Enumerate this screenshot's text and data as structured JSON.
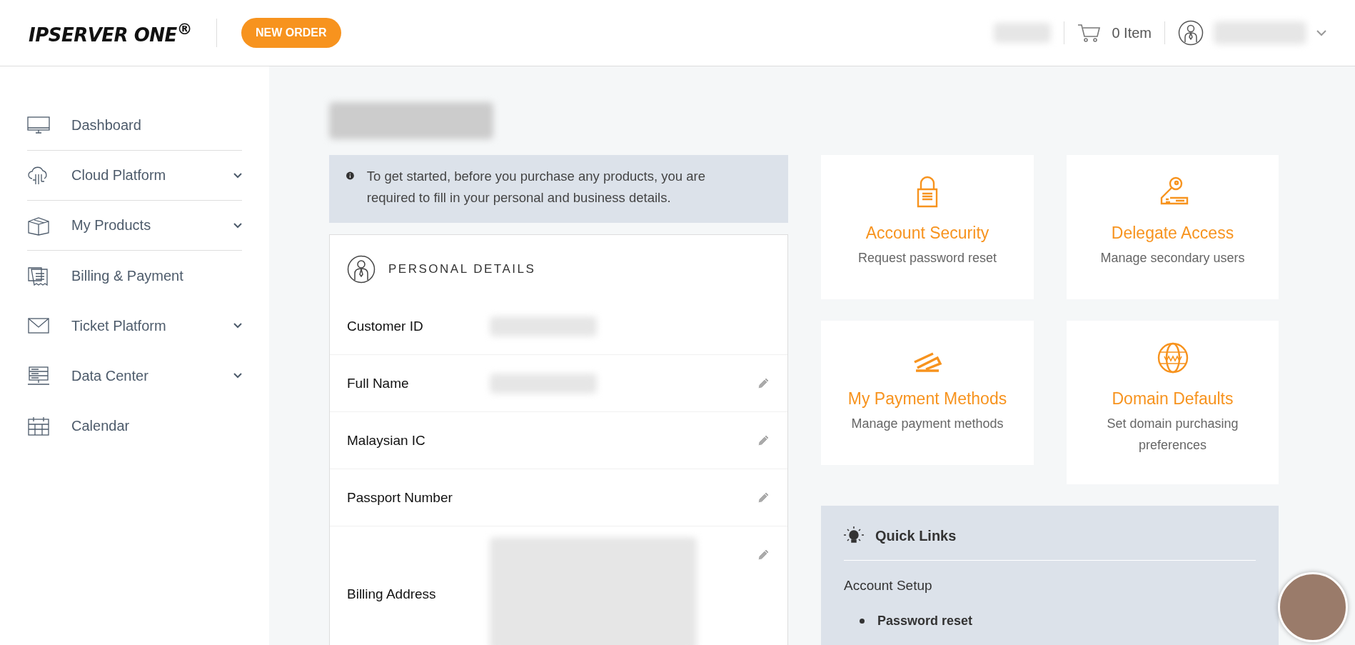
{
  "header": {
    "logo": "IPSERVER ONE$^{®}$",
    "new_order": "NEW ORDER",
    "cart": "0 Item"
  },
  "sidebar": {
    "items": [
      {
        "label": "Dashboard",
        "kind": "monitor",
        "expandable": false,
        "divider": true
      },
      {
        "label": "Cloud Platform",
        "kind": "cloud",
        "expandable": true,
        "divider": true
      },
      {
        "label": "My Products",
        "kind": "box",
        "expandable": true,
        "divider": true
      },
      {
        "label": "Billing & Payment",
        "kind": "receipt",
        "expandable": false,
        "divider": false
      },
      {
        "label": "Ticket Platform",
        "kind": "mail",
        "expandable": true,
        "divider": false
      },
      {
        "label": "Data Center",
        "kind": "server",
        "expandable": true,
        "divider": false
      },
      {
        "label": "Calendar",
        "kind": "calendar",
        "expandable": false,
        "divider": false
      }
    ]
  },
  "notice": "To get started, before you purchase any products, you are required to fill in your personal and business details.",
  "personal_details": {
    "title": "PERSONAL DETAILS",
    "fields": [
      {
        "label": "Customer ID",
        "blurred_value": true,
        "editable": false,
        "multiline": false
      },
      {
        "label": "Full Name",
        "blurred_value": true,
        "editable": true,
        "multiline": false
      },
      {
        "label": "Malaysian IC",
        "blurred_value": false,
        "editable": true,
        "multiline": false
      },
      {
        "label": "Passport Number",
        "blurred_value": false,
        "editable": true,
        "multiline": false
      },
      {
        "label": "Billing Address",
        "blurred_value": true,
        "editable": true,
        "multiline": true
      }
    ]
  },
  "cards": [
    {
      "kind": "lock",
      "title": "Account Security",
      "subtitle": "Request password reset"
    },
    {
      "kind": "key",
      "title": "Delegate Access",
      "subtitle": "Manage secondary users"
    },
    {
      "kind": "card",
      "title": "My Payment Methods",
      "subtitle": "Manage payment methods"
    },
    {
      "kind": "globe",
      "title": "Domain Defaults",
      "subtitle": "Set domain purchasing preferences"
    }
  ],
  "quick_links": {
    "title": "Quick Links",
    "section": "Account Setup",
    "links": [
      "Password reset"
    ]
  }
}
